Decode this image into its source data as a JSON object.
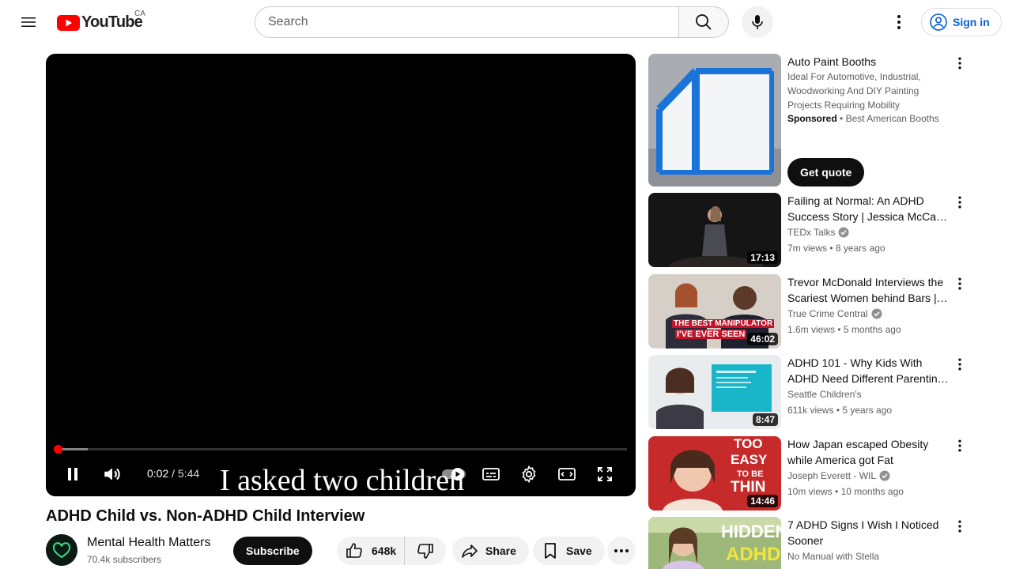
{
  "header": {
    "logo_text": "YouTube",
    "region": "CA",
    "search_placeholder": "Search",
    "signin_label": "Sign in"
  },
  "player": {
    "current_time": "0:02",
    "separator": " / ",
    "duration": "5:44",
    "caption": "I asked two children",
    "progress_played_fraction": 0.003,
    "progress_buffered_fraction": 0.052
  },
  "video": {
    "title": "ADHD Child vs. Non-ADHD Child Interview",
    "channel_name": "Mental Health Matters",
    "subscribers": "70.4k subscribers",
    "subscribe_label": "Subscribe",
    "likes": "648k",
    "share_label": "Share",
    "save_label": "Save"
  },
  "ad": {
    "title": "Auto Paint Booths",
    "description": "Ideal For Automotive, Industrial, Woodworking And DIY Painting Projects Requiring Mobility",
    "sponsored": "Sponsored",
    "dot": "•",
    "advertiser": "Best American Booths",
    "cta": "Get quote"
  },
  "recommendations": [
    {
      "title": "Failing at Normal: An ADHD Success Story | Jessica McCa…",
      "channel": "TEDx Talks",
      "verified": true,
      "views": "7m views",
      "age": "8 years ago",
      "duration": "17:13"
    },
    {
      "title": "Trevor McDonald Interviews the Scariest Women behind Bars | …",
      "channel": "True Crime Central",
      "verified": true,
      "views": "1.6m views",
      "age": "5 months ago",
      "duration": "46:02",
      "thumb_text1": "THE BEST MANIPULATOR",
      "thumb_text2": "I'VE EVER SEEN"
    },
    {
      "title": "ADHD 101 - Why Kids With ADHD Need Different Parentin…",
      "channel": "Seattle Children's",
      "verified": false,
      "views": "611k views",
      "age": "5 years ago",
      "duration": "8:47"
    },
    {
      "title": "How Japan escaped Obesity while America got Fat",
      "channel": "Joseph Everett - WIL",
      "verified": true,
      "views": "10m views",
      "age": "10 months ago",
      "duration": "14:46",
      "thumb_text1": "TOO",
      "thumb_text2": "EASY",
      "thumb_text3": "TO BE",
      "thumb_text4": "THIN"
    },
    {
      "title": "7 ADHD Signs I Wish I Noticed Sooner",
      "channel": "No Manual with Stella",
      "verified": false,
      "views": "",
      "age": "",
      "duration": "",
      "thumb_text1": "HIDDEN",
      "thumb_text2": "ADHD"
    }
  ],
  "colors": {
    "accent_red": "#ff0000",
    "link_blue": "#065fd4",
    "text_primary": "#0f0f0f",
    "text_secondary": "#606060"
  }
}
